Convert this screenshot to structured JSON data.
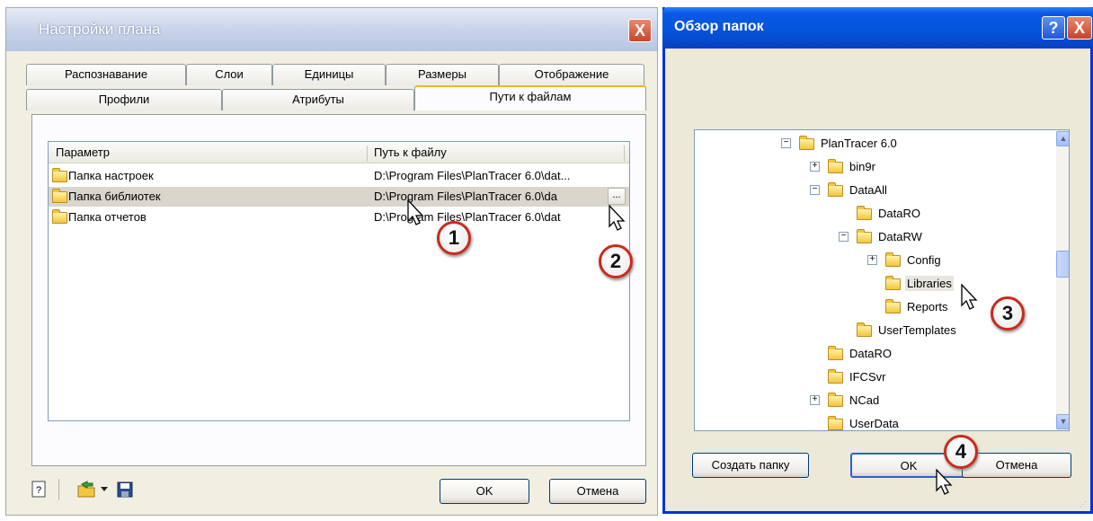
{
  "plan_dialog": {
    "title": "Настройки плана",
    "close": "X",
    "tabs_row1": [
      "Распознавание",
      "Слои",
      "Единицы",
      "Размеры",
      "Отображение"
    ],
    "tabs_row2": [
      "Профили",
      "Атрибуты",
      "Пути к файлам"
    ],
    "columns": [
      "Параметр",
      "Путь к файлу"
    ],
    "rows": [
      {
        "name": "Папка настроек",
        "path": "D:\\Program Files\\PlanTracer 6.0\\dat..."
      },
      {
        "name": "Папка библиотек",
        "path": "D:\\Program Files\\PlanTracer 6.0\\da"
      },
      {
        "name": "Папка отчетов",
        "path": "D:\\Program Files\\PlanTracer 6.0\\dat"
      }
    ],
    "dots_button": "...",
    "ok": "OK",
    "cancel": "Отмена"
  },
  "browse_dialog": {
    "title": "Обзор папок",
    "help": "?",
    "close": "X",
    "tree": [
      {
        "label": "PlanTracer 6.0",
        "expander": "−"
      },
      {
        "label": "bin9r",
        "expander": "+"
      },
      {
        "label": "DataAll",
        "expander": "−"
      },
      {
        "label": "DataRO",
        "expander": ""
      },
      {
        "label": "DataRW",
        "expander": "−"
      },
      {
        "label": "Config",
        "expander": "+"
      },
      {
        "label": "Libraries",
        "expander": ""
      },
      {
        "label": "Reports",
        "expander": ""
      },
      {
        "label": "UserTemplates",
        "expander": ""
      },
      {
        "label": "DataRO",
        "expander": ""
      },
      {
        "label": "IFCSvr",
        "expander": ""
      },
      {
        "label": "NCad",
        "expander": "+"
      },
      {
        "label": "UserData",
        "expander": ""
      }
    ],
    "new_folder": "Создать папку",
    "ok": "OK",
    "cancel": "Отмена"
  },
  "callouts": [
    "1",
    "2",
    "3",
    "4"
  ]
}
